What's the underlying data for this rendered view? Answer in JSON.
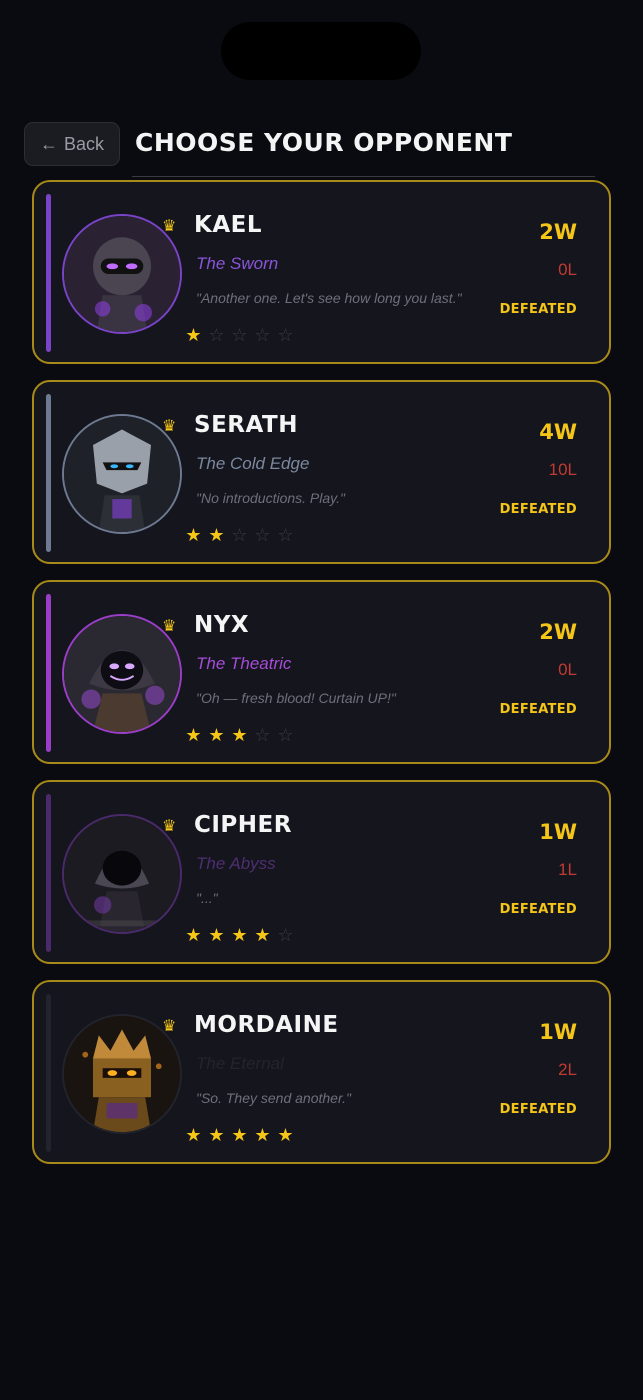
{
  "header": {
    "back_label": "Back",
    "title": "CHOOSE YOUR OPPONENT"
  },
  "opponents": [
    {
      "name": "KAEL",
      "subtitle": "The Sworn",
      "quote": "\"Another one. Let's see how long you last.\"",
      "wins": "2W",
      "losses": "0L",
      "status": "DEFEATED",
      "stars": 1,
      "accent_color": "#7a44c8",
      "subtitle_color": "#8a55d8",
      "avatar_icon": "ninja-avatar-icon"
    },
    {
      "name": "SERATH",
      "subtitle": "The Cold Edge",
      "quote": "\"No introductions. Play.\"",
      "wins": "4W",
      "losses": "10L",
      "status": "DEFEATED",
      "stars": 2,
      "accent_color": "#6e7a92",
      "subtitle_color": "#7c889e",
      "avatar_icon": "knight-avatar-icon"
    },
    {
      "name": "NYX",
      "subtitle": "The Theatric",
      "quote": "\"Oh — fresh blood! Curtain UP!\"",
      "wins": "2W",
      "losses": "0L",
      "status": "DEFEATED",
      "stars": 3,
      "accent_color": "#9a3ec8",
      "subtitle_color": "#a64cd8",
      "avatar_icon": "hooded-mage-avatar-icon"
    },
    {
      "name": "CIPHER",
      "subtitle": "The Abyss",
      "quote": "\"...\"",
      "wins": "1W",
      "losses": "1L",
      "status": "DEFEATED",
      "stars": 4,
      "accent_color": "#4a2a6a",
      "subtitle_color": "#4e2e70",
      "avatar_icon": "shadow-avatar-icon"
    },
    {
      "name": "MORDAINE",
      "subtitle": "The Eternal",
      "quote": "\"So. They send another.\"",
      "wins": "1W",
      "losses": "2L",
      "status": "DEFEATED",
      "stars": 5,
      "accent_color": "#22232c",
      "subtitle_color": "#24252c",
      "avatar_icon": "crowned-king-avatar-icon"
    }
  ],
  "colors": {
    "gold": "#f5c518",
    "card_border": "#a88a18",
    "loss_red": "#c23b30",
    "background": "#0a0b10",
    "card_bg": "#14151d"
  }
}
